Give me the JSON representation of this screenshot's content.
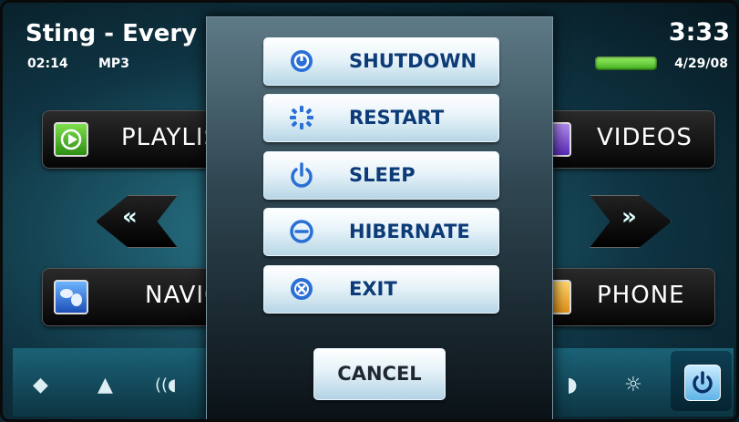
{
  "header": {
    "title": "Sting - Every Breath You Take",
    "elapsed": "02:14",
    "format": "MP3",
    "clock": "3:33",
    "date": "4/29/08"
  },
  "tiles": {
    "playlist": "PLAYLISTS",
    "videos": "VIDEOS",
    "nav": "NAVIGATION",
    "phone": "PHONE"
  },
  "arrows": {
    "left": "«",
    "right": "»"
  },
  "dialog": {
    "buttons": [
      {
        "label": "SHUTDOWN",
        "icon": "shutdown-icon"
      },
      {
        "label": "RESTART",
        "icon": "restart-icon"
      },
      {
        "label": "SLEEP",
        "icon": "sleep-icon"
      },
      {
        "label": "HIBERNATE",
        "icon": "hibernate-icon"
      },
      {
        "label": "EXIT",
        "icon": "exit-icon"
      }
    ],
    "cancel": "CANCEL"
  },
  "colors": {
    "accent": "#0d3b78",
    "battery": "#57c82a"
  }
}
